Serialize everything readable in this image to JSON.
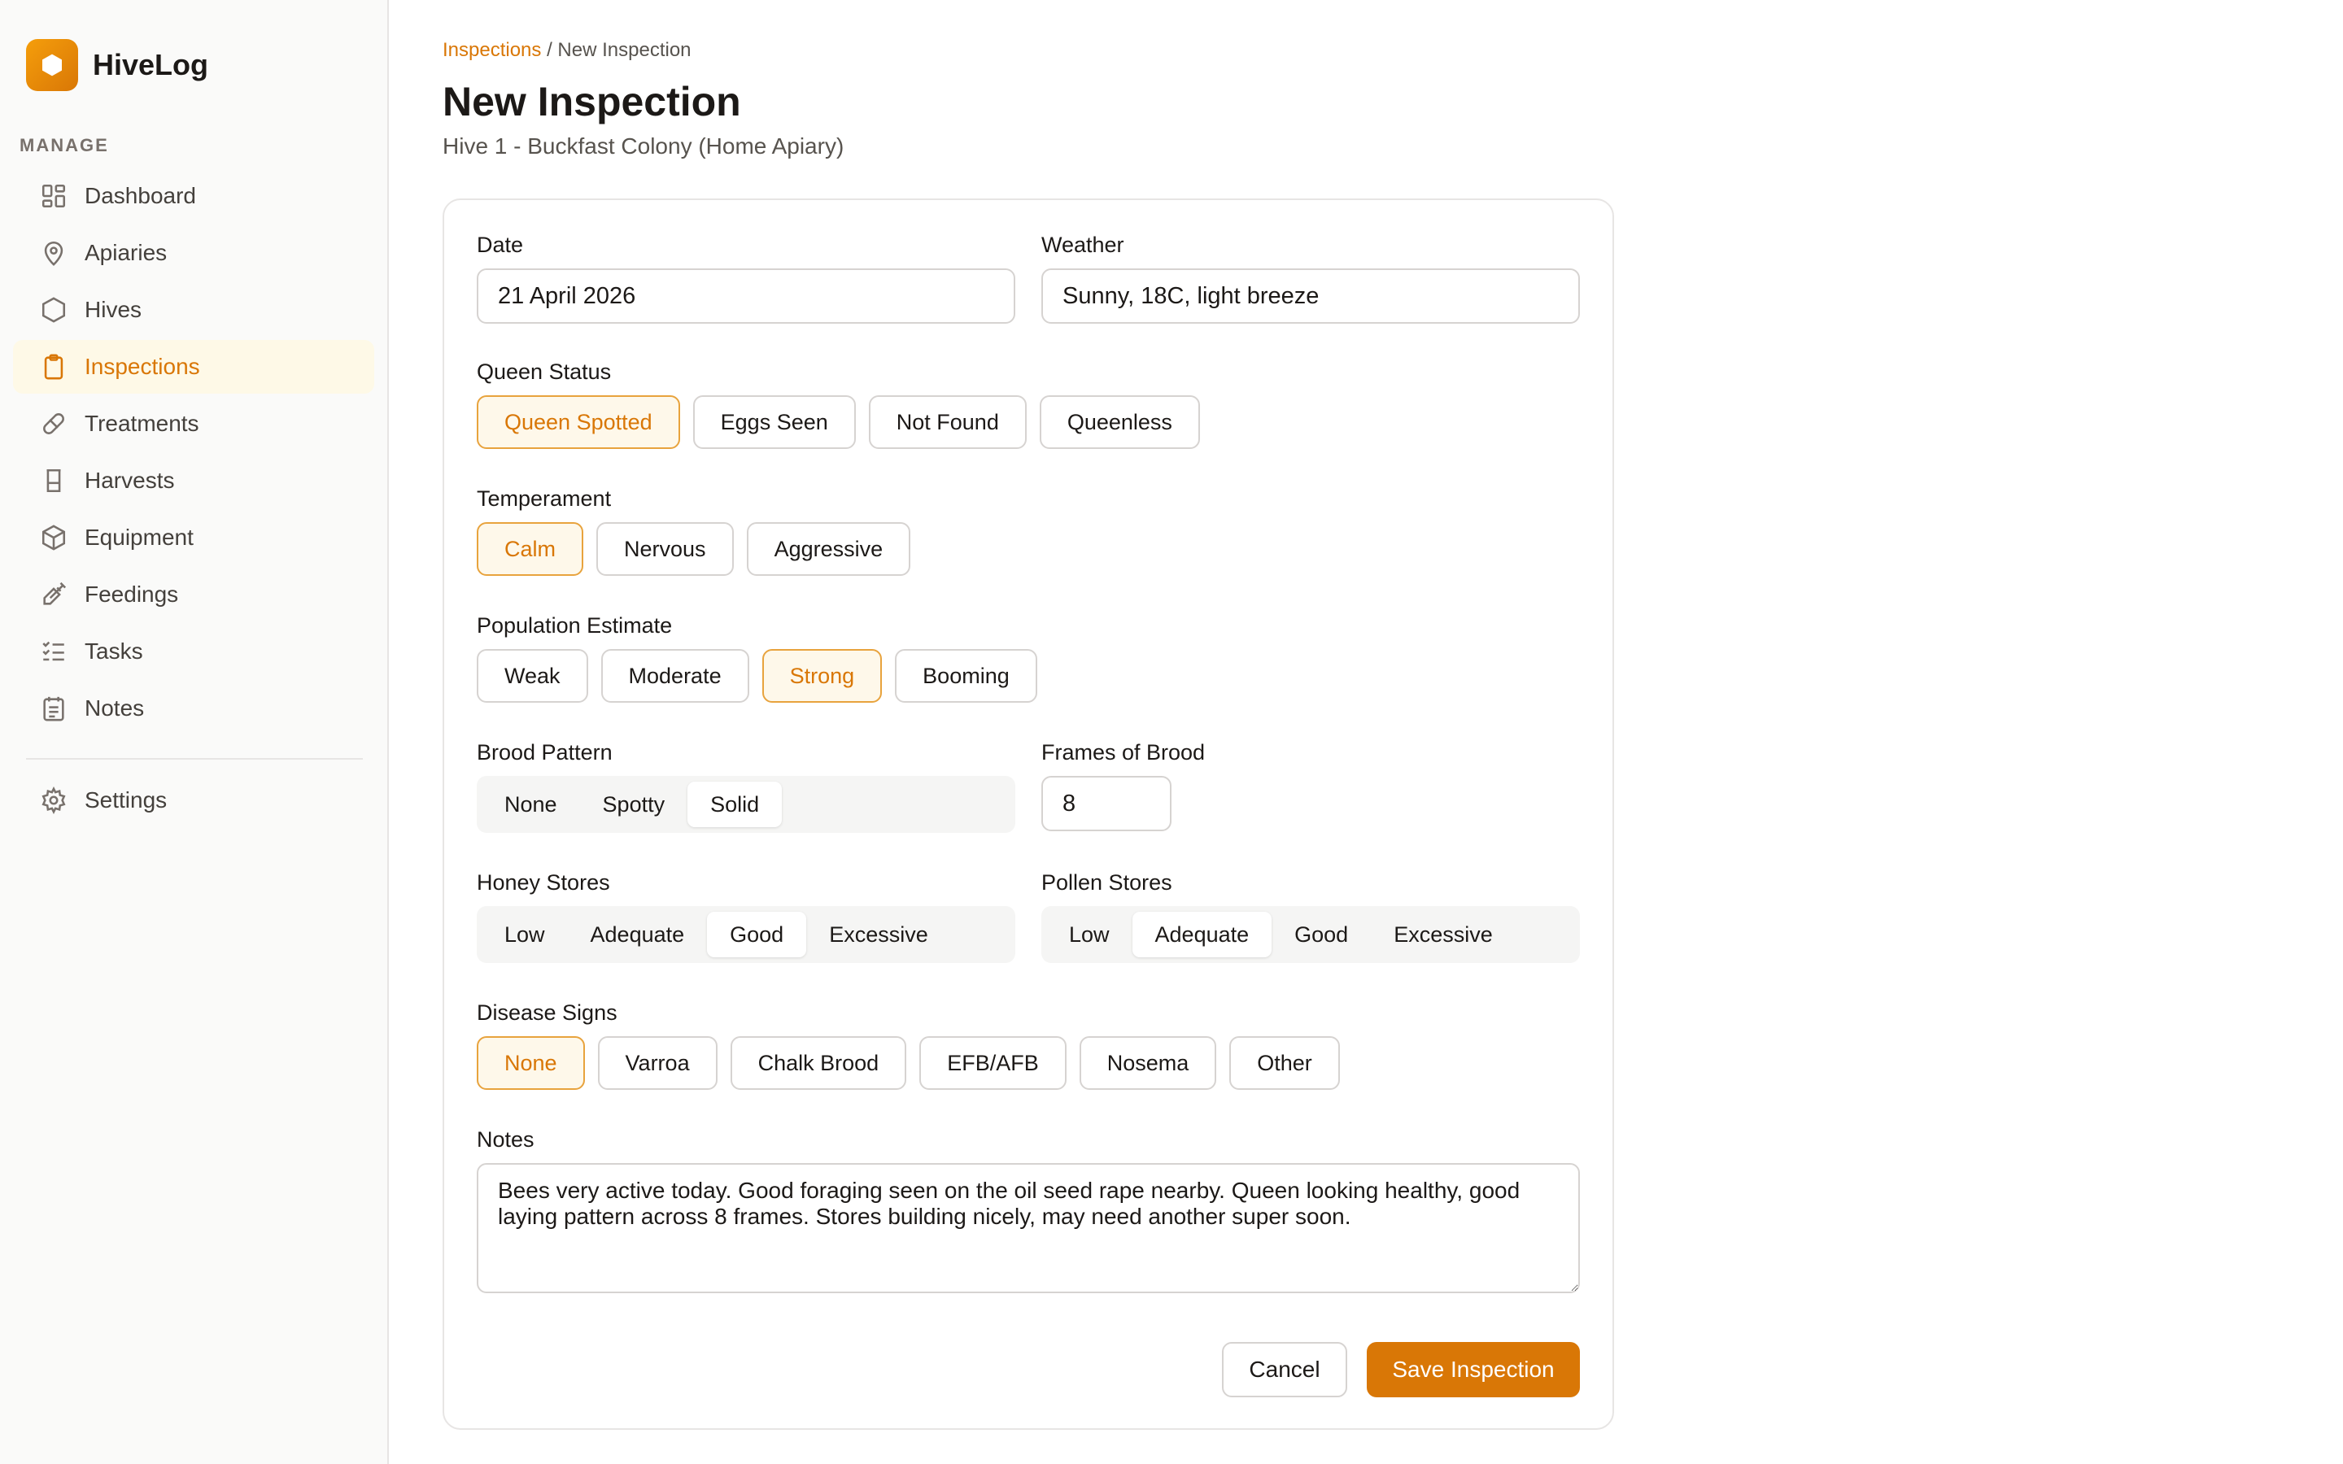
{
  "app": {
    "name": "HiveLog",
    "brand_color": "#d97706"
  },
  "sidebar": {
    "section_label": "MANAGE",
    "items": [
      {
        "label": "Dashboard",
        "icon": "dashboard-icon",
        "active": false
      },
      {
        "label": "Apiaries",
        "icon": "map-pin-icon",
        "active": false
      },
      {
        "label": "Hives",
        "icon": "hexagon-icon",
        "active": false
      },
      {
        "label": "Inspections",
        "icon": "clipboard-icon",
        "active": true
      },
      {
        "label": "Treatments",
        "icon": "pill-icon",
        "active": false
      },
      {
        "label": "Harvests",
        "icon": "jar-icon",
        "active": false
      },
      {
        "label": "Equipment",
        "icon": "box-icon",
        "active": false
      },
      {
        "label": "Feedings",
        "icon": "syringe-icon",
        "active": false
      },
      {
        "label": "Tasks",
        "icon": "checklist-icon",
        "active": false
      },
      {
        "label": "Notes",
        "icon": "notepad-icon",
        "active": false
      }
    ],
    "settings": {
      "label": "Settings",
      "icon": "gear-icon"
    }
  },
  "header": {
    "breadcrumb_parent": "Inspections",
    "breadcrumb_separator": " / ",
    "breadcrumb_current": "New Inspection",
    "title": "New Inspection",
    "subtitle": "Hive 1 - Buckfast Colony (Home Apiary)"
  },
  "form": {
    "date": {
      "label": "Date",
      "value": "21 April 2026"
    },
    "weather": {
      "label": "Weather",
      "value": "Sunny, 18C, light breeze"
    },
    "queen_status": {
      "label": "Queen Status",
      "options": [
        "Queen Spotted",
        "Eggs Seen",
        "Not Found",
        "Queenless"
      ],
      "selected": "Queen Spotted"
    },
    "temperament": {
      "label": "Temperament",
      "options": [
        "Calm",
        "Nervous",
        "Aggressive"
      ],
      "selected": "Calm"
    },
    "population": {
      "label": "Population Estimate",
      "options": [
        "Weak",
        "Moderate",
        "Strong",
        "Booming"
      ],
      "selected": "Strong"
    },
    "brood_pattern": {
      "label": "Brood Pattern",
      "options": [
        "None",
        "Spotty",
        "Solid"
      ],
      "selected": "Solid"
    },
    "frames_of_brood": {
      "label": "Frames of Brood",
      "value": "8"
    },
    "honey_stores": {
      "label": "Honey Stores",
      "options": [
        "Low",
        "Adequate",
        "Good",
        "Excessive"
      ],
      "selected": "Good"
    },
    "pollen_stores": {
      "label": "Pollen Stores",
      "options": [
        "Low",
        "Adequate",
        "Good",
        "Excessive"
      ],
      "selected": "Adequate"
    },
    "disease_signs": {
      "label": "Disease Signs",
      "options": [
        "None",
        "Varroa",
        "Chalk Brood",
        "EFB/AFB",
        "Nosema",
        "Other"
      ],
      "selected": "None"
    },
    "notes": {
      "label": "Notes",
      "value": "Bees very active today. Good foraging seen on the oil seed rape nearby. Queen looking healthy, good laying pattern across 8 frames. Stores building nicely, may need another super soon."
    },
    "cancel_label": "Cancel",
    "save_label": "Save Inspection"
  }
}
